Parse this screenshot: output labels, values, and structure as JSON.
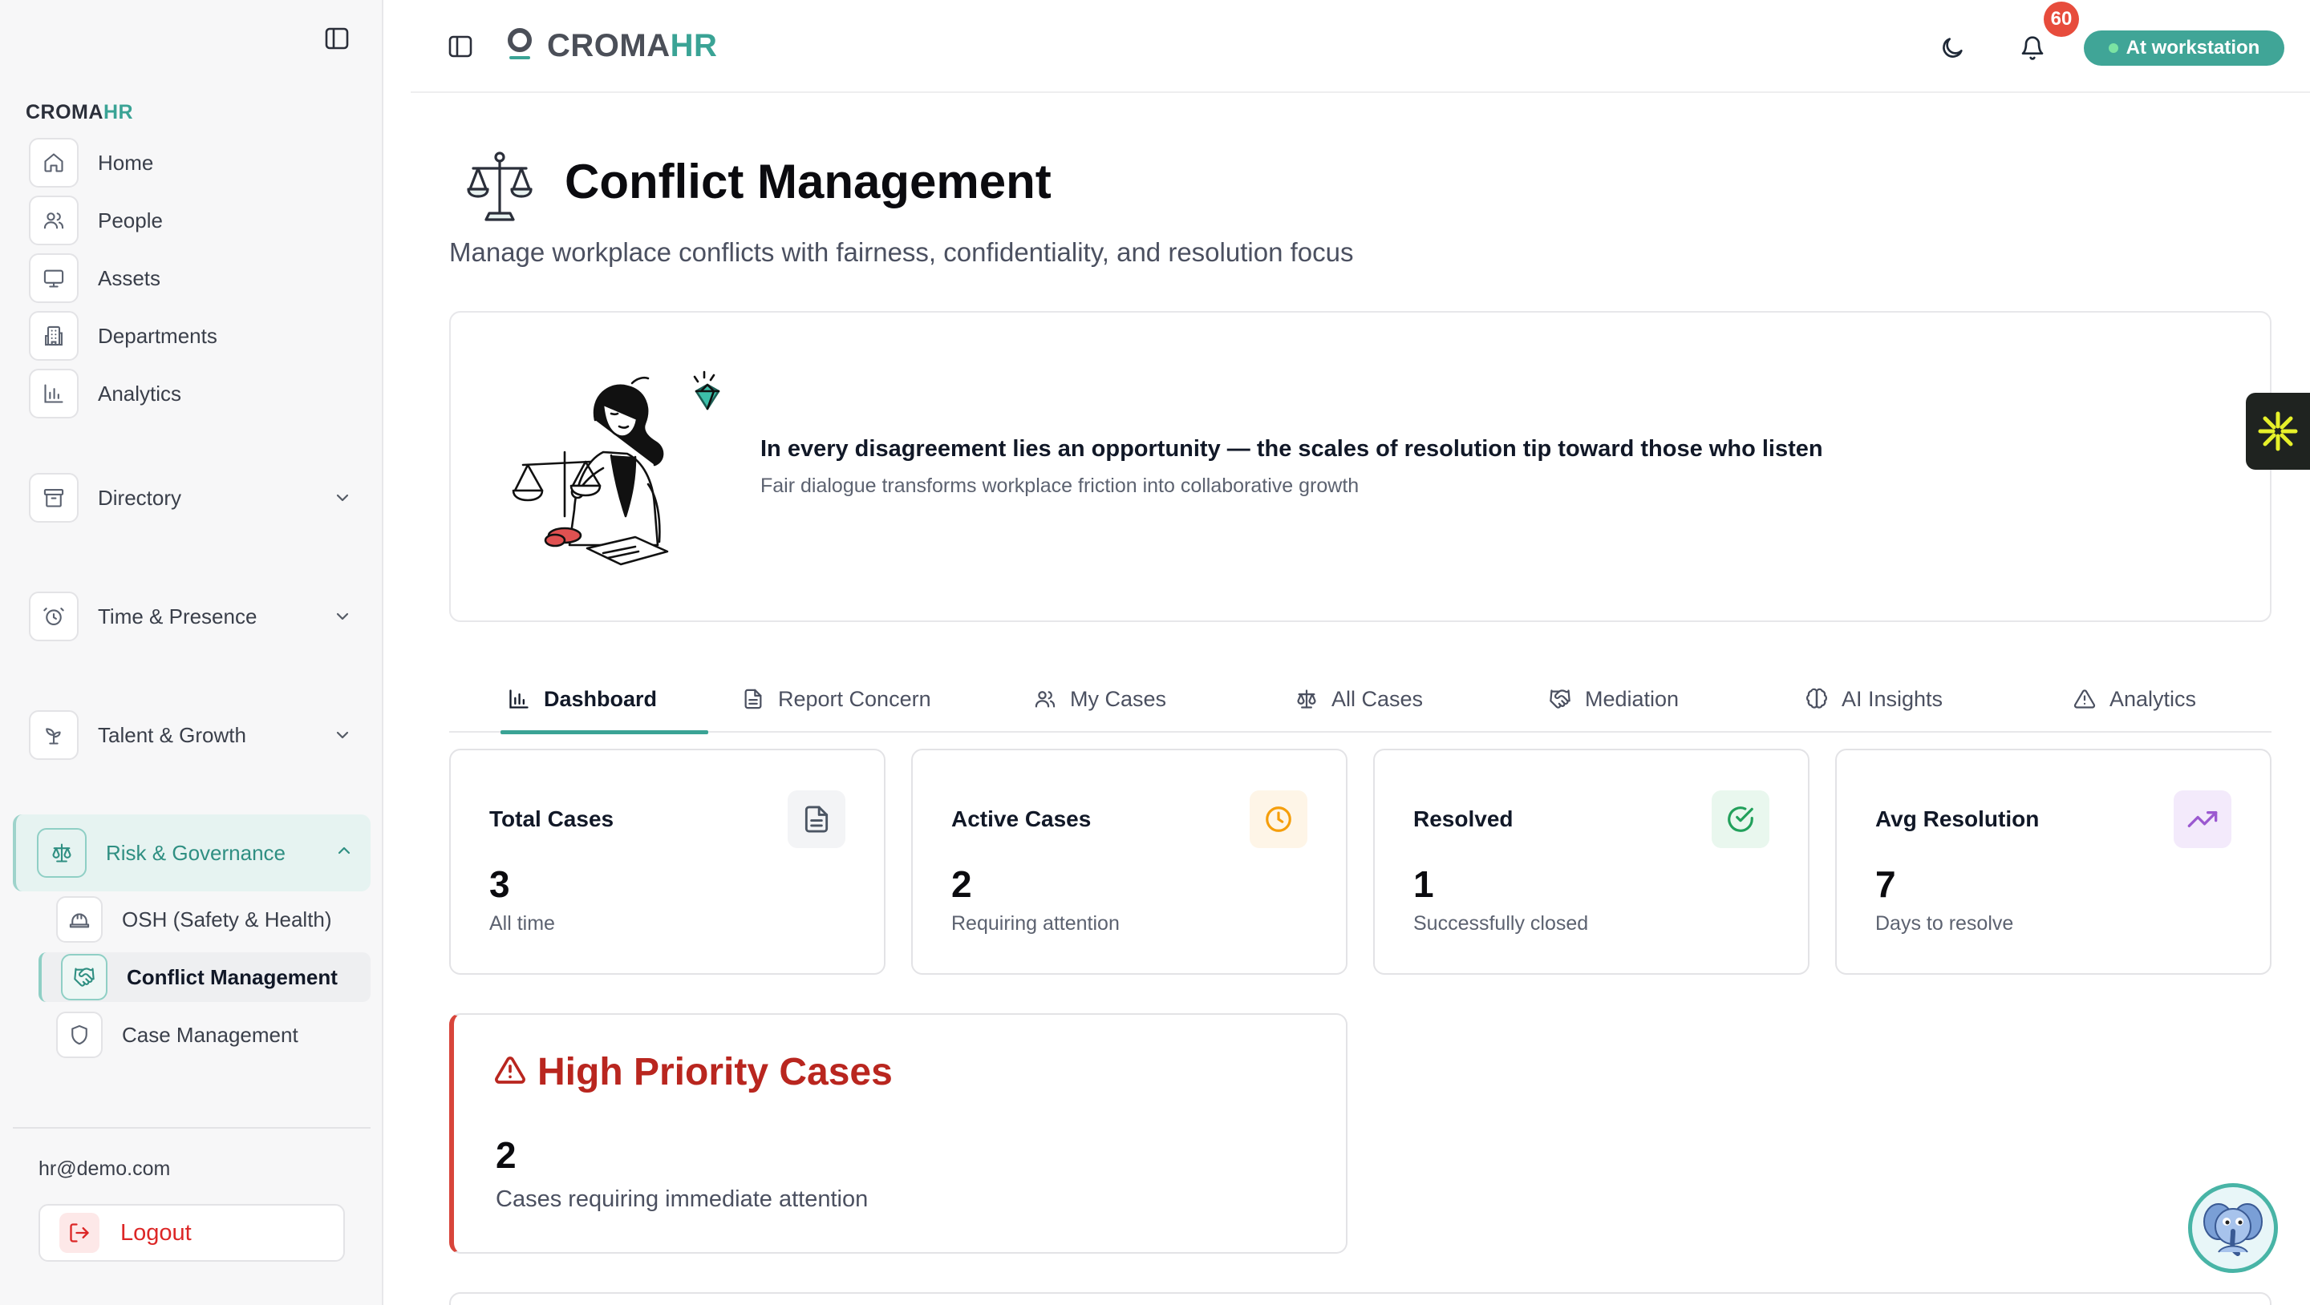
{
  "sidebar": {
    "brand_main": "CROMA",
    "brand_accent": "HR",
    "items": [
      {
        "label": "Home",
        "icon": "home-icon"
      },
      {
        "label": "People",
        "icon": "users-icon"
      },
      {
        "label": "Assets",
        "icon": "monitor-icon"
      },
      {
        "label": "Departments",
        "icon": "building-icon"
      },
      {
        "label": "Analytics",
        "icon": "bar-chart-icon"
      }
    ],
    "groups": [
      {
        "label": "Directory",
        "icon": "archive-icon",
        "expanded": false
      },
      {
        "label": "Time & Presence",
        "icon": "alarm-clock-icon",
        "expanded": false
      },
      {
        "label": "Talent & Growth",
        "icon": "sprout-icon",
        "expanded": false
      },
      {
        "label": "Risk & Governance",
        "icon": "scale-icon",
        "expanded": true
      }
    ],
    "sub_items": [
      {
        "label": "OSH (Safety & Health)",
        "icon": "hard-hat-icon"
      },
      {
        "label": "Conflict Management",
        "icon": "handshake-icon",
        "active": true
      },
      {
        "label": "Case Management",
        "icon": "shield-icon"
      }
    ],
    "email": "hr@demo.com",
    "logout_label": "Logout"
  },
  "topbar": {
    "logo_main": "CROMA",
    "logo_accent": "HR",
    "notification_count": "60",
    "status_label": "At workstation"
  },
  "page": {
    "title": "Conflict Management",
    "subtitle": "Manage workplace conflicts with fairness, confidentiality, and resolution focus"
  },
  "banner": {
    "quote": "In every disagreement lies an opportunity — the scales of resolution tip toward those who listen",
    "subtext": "Fair dialogue transforms workplace friction into collaborative growth"
  },
  "tabs": [
    {
      "label": "Dashboard",
      "icon": "bar-chart-icon",
      "active": true
    },
    {
      "label": "Report Concern",
      "icon": "file-text-icon"
    },
    {
      "label": "My Cases",
      "icon": "users-icon"
    },
    {
      "label": "All Cases",
      "icon": "scale-icon"
    },
    {
      "label": "Mediation",
      "icon": "handshake-icon"
    },
    {
      "label": "AI Insights",
      "icon": "brain-icon"
    },
    {
      "label": "Analytics",
      "icon": "warning-icon"
    }
  ],
  "stats": [
    {
      "label": "Total Cases",
      "value": "3",
      "sub": "All time",
      "icon": "file-text-icon",
      "color": "#6b7280",
      "bg": "#f3f4f6"
    },
    {
      "label": "Active Cases",
      "value": "2",
      "sub": "Requiring attention",
      "icon": "clock-icon",
      "color": "#f59e0b",
      "bg": "#fef5e7"
    },
    {
      "label": "Resolved",
      "value": "1",
      "sub": "Successfully closed",
      "icon": "check-circle-icon",
      "color": "#22a05b",
      "bg": "#e9f7ee"
    },
    {
      "label": "Avg Resolution",
      "value": "7",
      "sub": "Days to resolve",
      "icon": "trending-up-icon",
      "color": "#9b59d0",
      "bg": "#f3eafb"
    }
  ],
  "priority": {
    "title": "High Priority Cases",
    "value": "2",
    "sub": "Cases requiring immediate attention",
    "color": "#b9261f"
  },
  "colors": {
    "accent": "#3aa395",
    "danger": "#dc2626"
  }
}
